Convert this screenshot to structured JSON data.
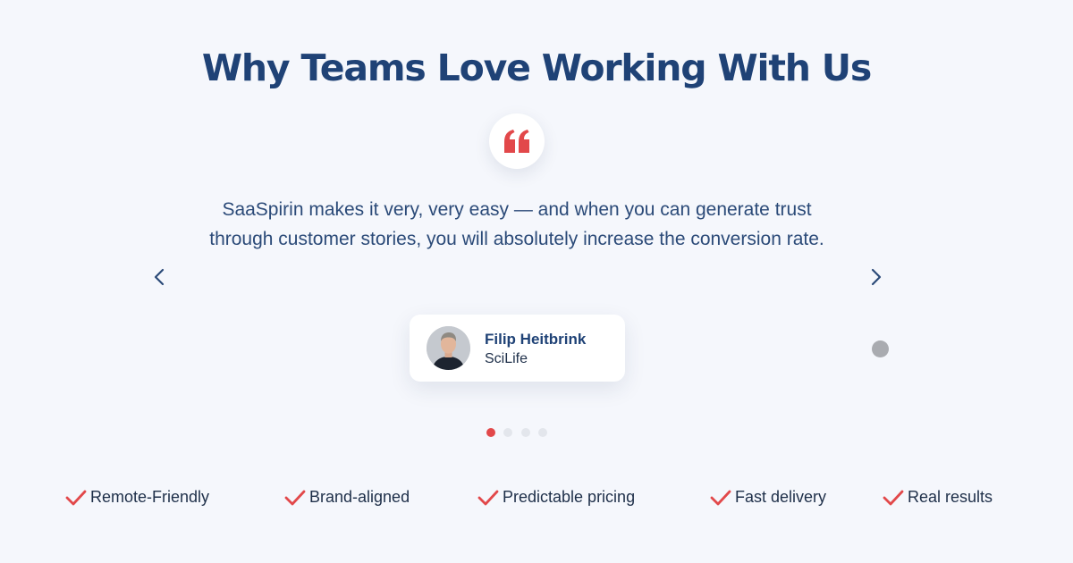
{
  "heading": "Why Teams Love Working With Us",
  "testimonial": {
    "quote": "SaaSpirin makes it very, very easy — and when you can generate trust through customer stories, you will absolutely increase the conversion rate.",
    "author_name": "Filip Heitbrink",
    "author_company": "SciLife",
    "quote_icon": "quote-icon"
  },
  "carousel": {
    "prev_icon": "chevron-left-icon",
    "next_icon": "chevron-right-icon",
    "slide_count": 4,
    "active_index": 0
  },
  "features": [
    {
      "label": "Remote-Friendly"
    },
    {
      "label": "Brand-aligned"
    },
    {
      "label": "Predictable pricing"
    },
    {
      "label": "Fast delivery"
    },
    {
      "label": "Real results"
    }
  ],
  "colors": {
    "heading": "#1f4276",
    "accent": "#e2484a",
    "background": "#f5f7fc",
    "text": "#2b4a78"
  }
}
